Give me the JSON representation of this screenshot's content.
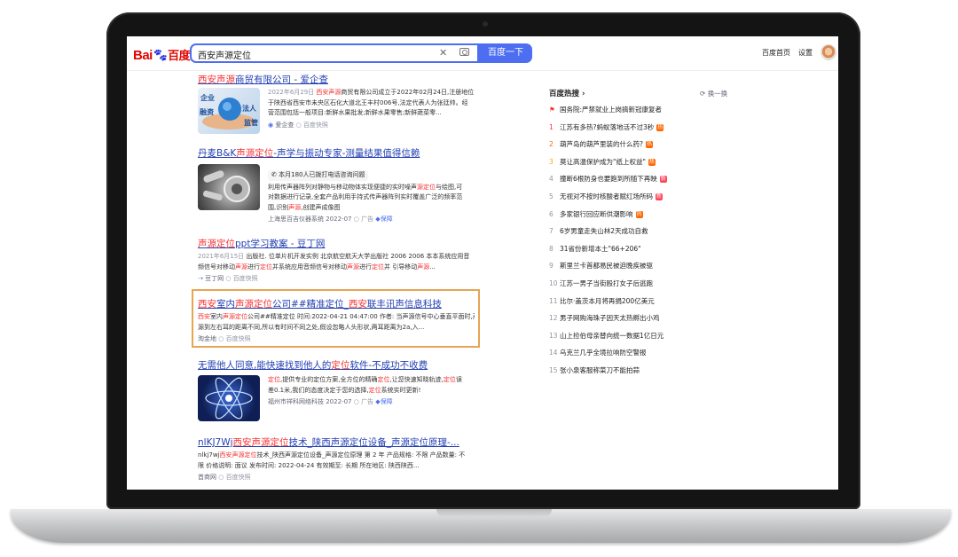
{
  "header": {
    "logo_bai": "Bai",
    "logo_du": "百度",
    "query": "西安声源定位",
    "search_button": "百度一下",
    "home_link": "百度首页",
    "settings_link": "设置"
  },
  "results": [
    {
      "title_parts": [
        "西安声源",
        "商贸有限公司 - 爱企查"
      ],
      "thumb_words": [
        "企业",
        "融资",
        "法人",
        "监管"
      ],
      "abstract": {
        "date": "2022年6月29日",
        "l1_pre": "",
        "l1_hit": "西安声源",
        "l1_post": "商贸有限公司成立于2022年02月24日,注册地位",
        "l2": "于陕西省西安市未央区石化大道北王丰村006号,法定代表人为张廷帅。经",
        "l3": "营范围包括一般项目:新鲜水果批发;新鲜水果零售;新鲜蔬菜零..."
      },
      "source": "爱企查",
      "kuaizhao": "百度快照"
    },
    {
      "title_pre": "丹麦B&K",
      "title_hit": "声源定位",
      "title_post": "-声学与振动专家-测量结果值得信赖",
      "tagline": "本月180人已拨打电话咨询问题",
      "l1_pre": "利用传声器阵列对静物与移动物体实现便捷的实时噪声",
      "l1_hit": "源定位",
      "l1_post": "与绘图,可",
      "l2": "对数据进行记录,全套产品利用手持式传声器阵列实时覆盖广泛的频率范",
      "l3_pre": "围,识别",
      "l3_hit": "声源",
      "l3_post": ",创建声成像图",
      "source": "上海思百吉仪器系统 2022-07",
      "ad": "广告",
      "bao": "保障"
    },
    {
      "title_hit": "声源定位",
      "title_post": "ppt学习教案 - 豆丁网",
      "date": "2021年6月15日",
      "l1": "出版社. 位单片机开发实例 北京航空航天大学出版社 2006 2006 本本系统应用音",
      "l2_pre": "频信号对移动",
      "l2_hit1": "声源",
      "l2_mid": "进行",
      "l2_hit2": "定位",
      "l2_mid2": "并系统应用音频信号对移动",
      "l2_hit3": "声源",
      "l2_mid3": "进行",
      "l2_hit4": "定位",
      "l2_post": "并 引导移动",
      "l2_hit5": "声源",
      "l2_end": "...",
      "source": "豆丁网",
      "kuaizhao": "百度快照"
    },
    {
      "title_hit1": "西安",
      "title_mid1": "室内",
      "title_hit2": "声源定位",
      "title_mid2": "公司##精准定位_",
      "title_hit3": "西安",
      "title_post": "联丰讯声信息科技",
      "l1_hit1": "西安",
      "l1_mid": "室内",
      "l1_hit2": "声源定位",
      "l1_post": "公司##精准定位 时间:2022-04-21 04:47:00 作者: 当声源信号中心垂直平面时,声",
      "l2": "源到左右耳的距离不同,所以有时间不同之处,假设忽略人头形状,两耳距离为2a,入...",
      "source": "淘金地",
      "kuaizhao": "百度快照"
    },
    {
      "title_pre": "无需他人同意,能快速找到他人的",
      "title_hit": "定位",
      "title_post": "软件-不成功不收费",
      "l1_hit1": "定位",
      "l1_mid": ",提供专业的定位方案,全方位的精确",
      "l1_hit2": "定位",
      "l1_mid2": ",让您快速知晓轨迹,",
      "l1_hit3": "定位",
      "l1_post": "误",
      "l2_pre": "差0.1米,我们的态度决定于您的选择,",
      "l2_hit": "定位",
      "l2_post": "系统实时更新!",
      "source": "福州市祥科网络科技 2022-07",
      "ad": "广告",
      "bao": "保障"
    },
    {
      "title_pre": "nlKJ7Wj",
      "title_hit": "西安声源定位",
      "title_post": "技术_陕西声源定位设备_声源定位原理-...",
      "l1_pre": "nlkj7wj",
      "l1_hit": "西安声源定位",
      "l1_post": "技术_陕西声源定位设备_声源定位原理 第 2 年 产品规格: 不限 产品数量: 不",
      "l2": "限 价格说明: 面议 发布时间: 2022-04-24 有效期至: 长期 所在地区: 陕西陕西...",
      "source": "首商网",
      "kuaizhao": "百度快照"
    }
  ],
  "hot": {
    "title": "百度热搜 ›",
    "refresh": "换一换",
    "items": [
      {
        "n": "",
        "text": "国务院:严禁就业上岗搞新冠康复者",
        "badge": ""
      },
      {
        "n": "1",
        "text": "江苏有多热?蚂蚁落地活不过3秒",
        "badge": "热"
      },
      {
        "n": "2",
        "text": "葫芦岛的葫芦里装的什么药?",
        "badge": "热"
      },
      {
        "n": "3",
        "text": "莫让高温保护成为\"纸上权益\"",
        "badge": "热"
      },
      {
        "n": "4",
        "text": "撞断6根防身也要跑到所随下再映",
        "badge": "新"
      },
      {
        "n": "5",
        "text": "无视对不按时核酸者赋红场所码",
        "badge": "新"
      },
      {
        "n": "6",
        "text": "多家银行回应断供潮影响",
        "badge": "热"
      },
      {
        "n": "7",
        "text": "6岁男童走失山林2天成功自救",
        "badge": ""
      },
      {
        "n": "8",
        "text": "31省份新增本土\"66+206\"",
        "badge": ""
      },
      {
        "n": "9",
        "text": "斯里兰卡首都易民被迫晚疾被驱",
        "badge": ""
      },
      {
        "n": "10",
        "text": "江苏一男子当街殴打女子后逃跑",
        "badge": ""
      },
      {
        "n": "11",
        "text": "比尔·盖茨本月将再捐200亿美元",
        "badge": ""
      },
      {
        "n": "12",
        "text": "男子网购海珠子因天太热孵出小鸡",
        "badge": ""
      },
      {
        "n": "13",
        "text": "山上捡伯母亲替向统一数据1亿日元",
        "badge": ""
      },
      {
        "n": "14",
        "text": "乌克兰几乎全境拉响防空警报",
        "badge": ""
      },
      {
        "n": "15",
        "text": "张小泉客服称菜刀不能拍蒜",
        "badge": ""
      }
    ]
  },
  "colors": {
    "brand_blue": "#4e6ef2",
    "link": "#2440b3",
    "hit": "#f73131",
    "highlight": "#e7a454",
    "hot_badge": "#ff6600",
    "new_badge": "#ff455b"
  }
}
